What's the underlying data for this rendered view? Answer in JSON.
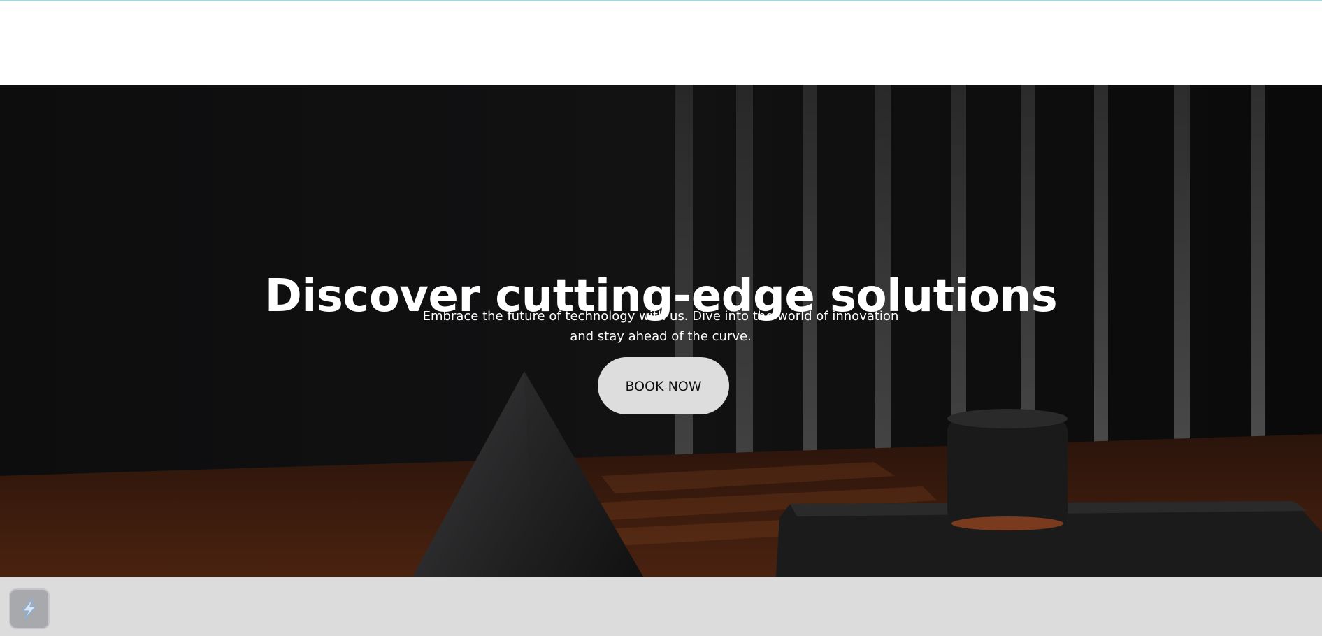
{
  "hero": {
    "title": "Discover cutting-edge solutions",
    "subtitle_line1": "Embrace the future of technology with us. Dive into the world of innovation",
    "subtitle_line2": "and stay ahead of the curve.",
    "cta_label": "BOOK NOW"
  },
  "widget": {
    "icon": "bolt-icon"
  },
  "colors": {
    "accent_line": "#a9d6d9",
    "cta_background": "#dddddd",
    "footer_strip": "#dcdcdc"
  }
}
